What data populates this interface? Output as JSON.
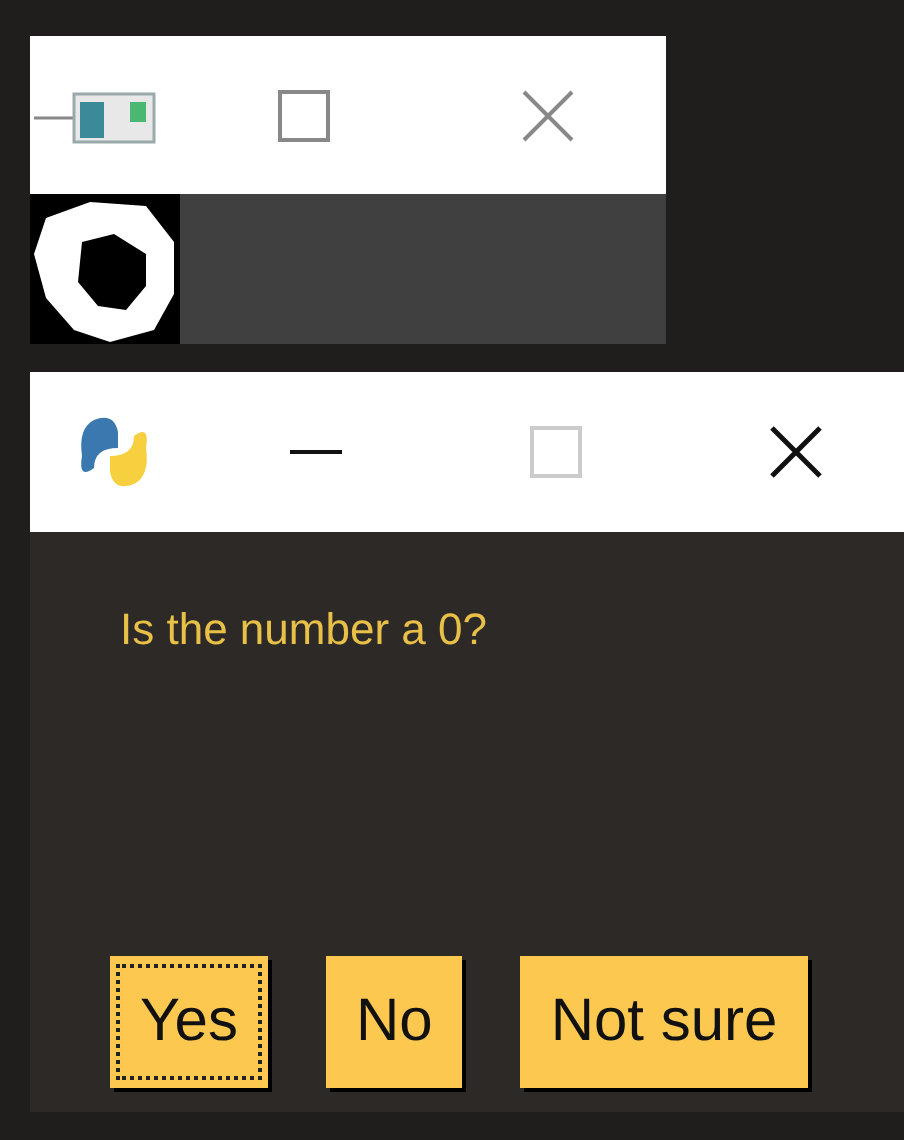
{
  "preview_window": {
    "title_controls": [
      {
        "kind": "thumbnail"
      },
      {
        "kind": "maximize"
      },
      {
        "kind": "close"
      }
    ],
    "image": {
      "kind": "digit"
    }
  },
  "dialog": {
    "title_controls": [
      {
        "kind": "logo"
      },
      {
        "kind": "minimize"
      },
      {
        "kind": "maximize"
      },
      {
        "kind": "close"
      }
    ],
    "message": "Is the number a 0?",
    "buttons": [
      {
        "label": "Yes",
        "focused": true
      },
      {
        "label": "No",
        "focused": false
      },
      {
        "label": "Not sure",
        "focused": false
      }
    ]
  }
}
